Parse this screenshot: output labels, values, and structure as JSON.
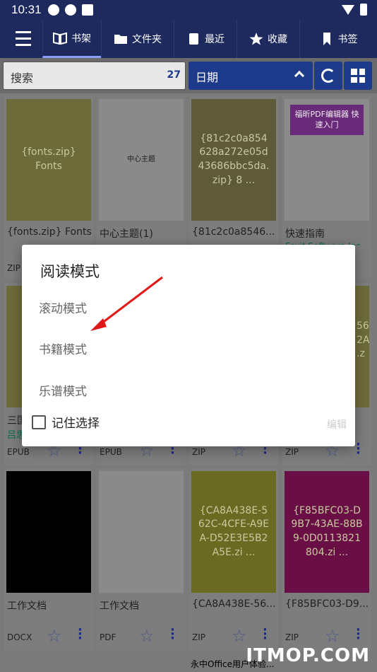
{
  "statusbar": {
    "time": "10:31"
  },
  "nav": {
    "tabs": [
      {
        "label": "书架",
        "icon": "book-open-icon",
        "active": true
      },
      {
        "label": "文件夹",
        "icon": "folder-icon",
        "active": false
      },
      {
        "label": "最近",
        "icon": "recent-book-icon",
        "active": false
      },
      {
        "label": "收藏",
        "icon": "star-icon",
        "active": false
      },
      {
        "label": "书签",
        "icon": "bookmark-icon",
        "active": false
      }
    ]
  },
  "filter": {
    "search_label": "搜索",
    "count": "27",
    "sort_label": "日期"
  },
  "cards": [
    {
      "cover": "{fonts.zip}\nFonts",
      "title": "{fonts.zip} Fonts",
      "format": "ZIP",
      "cover_color": "#6e6b3a"
    },
    {
      "cover": "中心主题",
      "title": "中心主题(1)",
      "format": "",
      "cover_color": "#8a8a8a"
    },
    {
      "cover": "{81c2c0a854628a272e05d43686bbc5da.zip} 8 ...",
      "title": "{81c2c0a8546...",
      "format": "",
      "cover_color": "#5e5a3a"
    },
    {
      "cover": "福昕PDF编辑器 快速入门",
      "title": "快速指南",
      "format": "",
      "cover_color": "#8a8a8a"
    },
    {
      "title": "三国",
      "subtitle": "吕思",
      "format": "EPUB",
      "cover_color": "#6e6b3a"
    },
    {
      "title": "",
      "format": "EPUB",
      "cover_color": "#8a8a8a"
    },
    {
      "title": "",
      "format": "ZIP",
      "cover_color": "#5e5a3a"
    },
    {
      "title": "",
      "format": "ZIP",
      "cover_color": "#6e6b3a"
    },
    {
      "cover": "",
      "title": "工作文档",
      "format": "DOCX",
      "cover_color": "#000000"
    },
    {
      "cover": "",
      "title": "工作文档",
      "format": "PDF",
      "cover_color": "#8a8a8a"
    },
    {
      "cover": "{CA8A438E-562C-4CFE-A9EA-D52E3E5B2A5E.zi ...",
      "title": "{CA8A438E-56...",
      "format": "ZIP",
      "cover_color": "#6b6a22"
    },
    {
      "cover": "{F85BFC03-D9B7-43AE-88B9-0D0113821804.zi ...",
      "title": "{F85BFC03-D9...",
      "format": "ZIP",
      "cover_color": "#6a0f45"
    }
  ],
  "partial_texts": {
    "foxit_author": "Foxit Software Inc.",
    "cover_right_partial": "56\n2A\n.z",
    "bottom_title": "永中Office用户体验..."
  },
  "dialog": {
    "title": "阅读模式",
    "options": [
      "滚动模式",
      "书籍模式",
      "乐谱模式"
    ],
    "remember_label": "记住选择",
    "edit_label": "编辑"
  },
  "watermark": "ITMOP.COM"
}
